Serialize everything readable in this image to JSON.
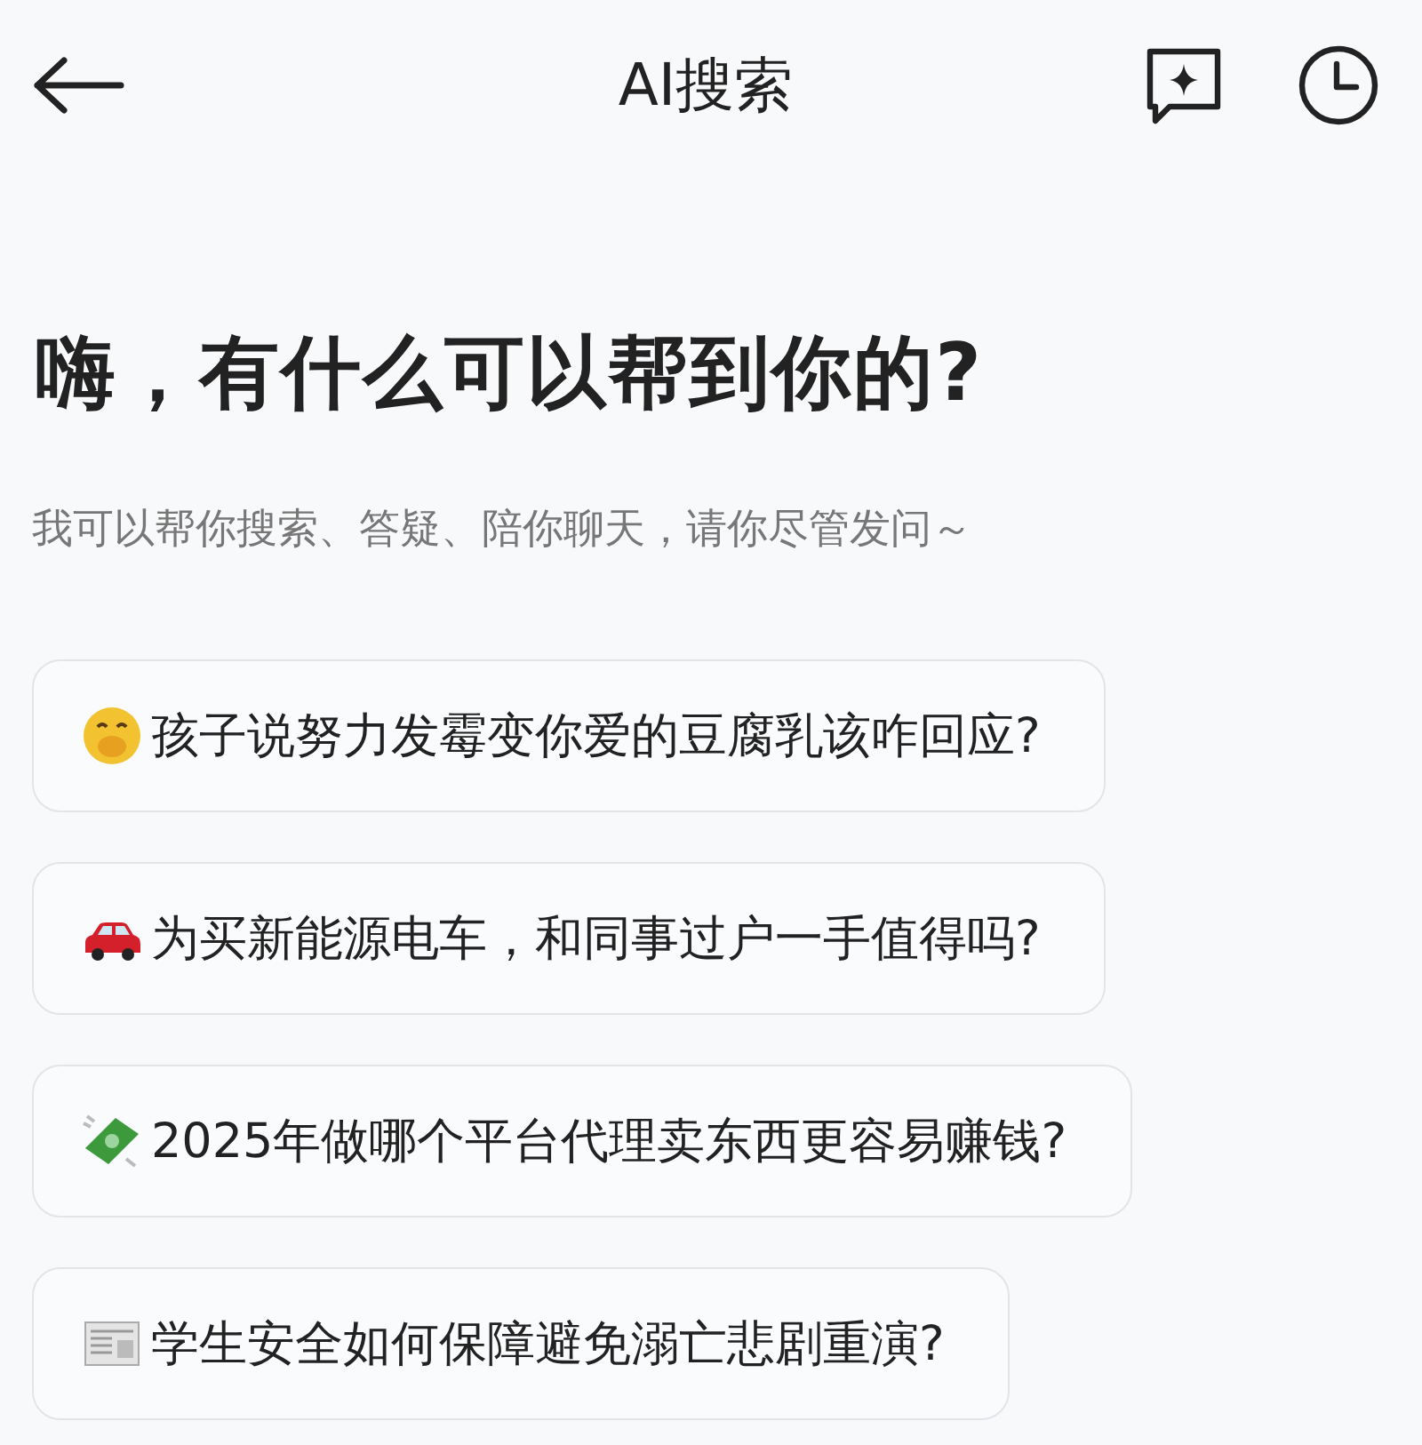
{
  "header": {
    "title": "AI搜索"
  },
  "greeting": "嗨，有什么可以帮到你的?",
  "subtitle": "我可以帮你搜索、答疑、陪你聊天，请你尽管发问～",
  "suggestions": [
    {
      "kind": "face",
      "text": "孩子说努力发霉变你爱的豆腐乳该咋回应?"
    },
    {
      "kind": "car",
      "text": "为买新能源电车，和同事过户一手值得吗?"
    },
    {
      "kind": "money",
      "text": "2025年做哪个平台代理卖东西更容易赚钱?"
    },
    {
      "kind": "newspaper",
      "text": "学生安全如何保障避免溺亡悲剧重演?"
    }
  ]
}
